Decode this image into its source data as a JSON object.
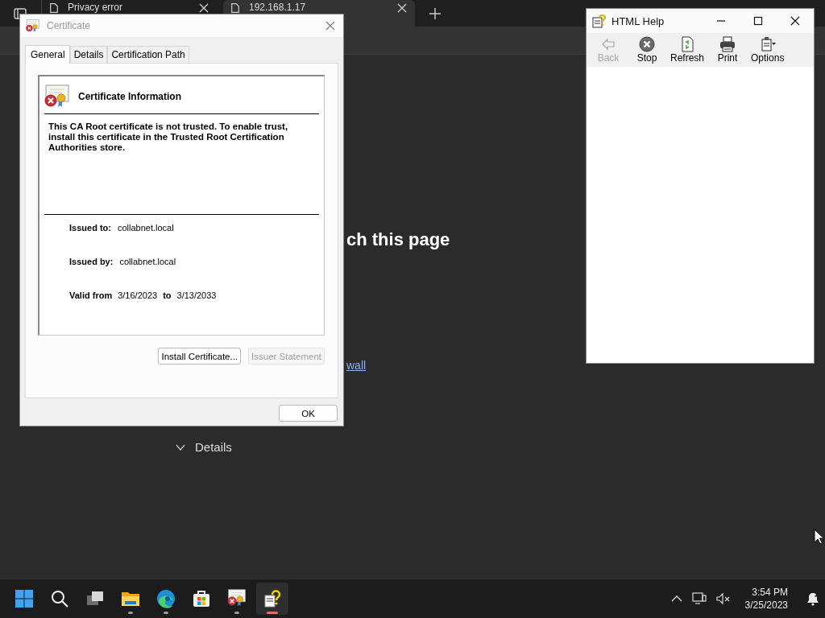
{
  "browser": {
    "tabs": [
      {
        "title": "Privacy error",
        "selected": false
      },
      {
        "title": "192.168.1.17",
        "selected": true
      }
    ],
    "page": {
      "heading": "ch this page",
      "link": "wall",
      "details": "Details"
    }
  },
  "certificate_dialog": {
    "title": "Certificate",
    "tabs": [
      {
        "label": "General",
        "selected": true
      },
      {
        "label": "Details",
        "selected": false
      },
      {
        "label": "Certification Path",
        "selected": false
      }
    ],
    "info_title": "Certificate Information",
    "message": "This CA Root certificate is not trusted. To enable trust, install this certificate in the Trusted Root Certification Authorities store.",
    "fields": [
      {
        "label": "Issued to:",
        "value": "collabnet.local"
      },
      {
        "label": "Issued by:",
        "value": "collabnet.local"
      }
    ],
    "validity": {
      "label": "Valid from",
      "from": "3/16/2023",
      "to_label": "to",
      "to": "3/13/2033"
    },
    "buttons": [
      {
        "label": "Install Certificate...",
        "disabled": false
      },
      {
        "label": "Issuer Statement",
        "disabled": true
      }
    ],
    "ok": "OK"
  },
  "help_window": {
    "title": "HTML Help",
    "toolbar": [
      {
        "kind": "back",
        "label": "Back",
        "disabled": true
      },
      {
        "kind": "stop",
        "label": "Stop",
        "disabled": false
      },
      {
        "kind": "refresh",
        "label": "Refresh",
        "disabled": false
      },
      {
        "kind": "print",
        "label": "Print",
        "disabled": false
      },
      {
        "kind": "options",
        "label": "Options",
        "disabled": false
      }
    ]
  },
  "taskbar": {
    "apps": [
      {
        "kind": "start",
        "running": false,
        "selected": false
      },
      {
        "kind": "search",
        "running": false,
        "selected": false
      },
      {
        "kind": "taskview",
        "running": false,
        "selected": false
      },
      {
        "kind": "explorer",
        "running": true,
        "selected": false
      },
      {
        "kind": "edge",
        "running": true,
        "selected": false
      },
      {
        "kind": "store",
        "running": false,
        "selected": false
      },
      {
        "kind": "certificate",
        "running": true,
        "selected": false
      },
      {
        "kind": "help",
        "running": true,
        "selected": true
      }
    ],
    "time": "3:54 PM",
    "date": "3/25/2023"
  }
}
